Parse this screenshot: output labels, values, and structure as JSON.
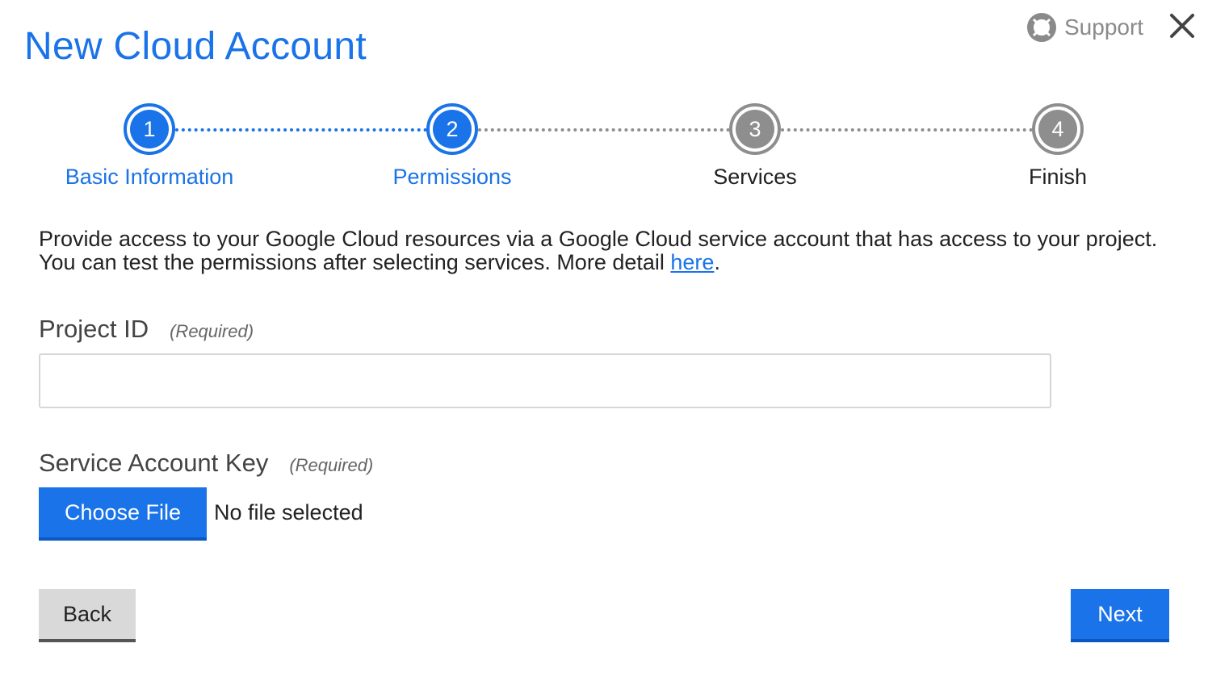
{
  "dialog": {
    "title": "New Cloud Account",
    "support_label": "Support"
  },
  "stepper": {
    "steps": [
      {
        "number": "1",
        "label": "Basic Information",
        "state": "active"
      },
      {
        "number": "2",
        "label": "Permissions",
        "state": "active"
      },
      {
        "number": "3",
        "label": "Services",
        "state": "inactive"
      },
      {
        "number": "4",
        "label": "Finish",
        "state": "inactive"
      }
    ]
  },
  "description": {
    "text": "Provide access to your Google Cloud resources via a Google Cloud service account that has access to your project. You can test the permissions after selecting services. More detail ",
    "link_text": "here",
    "suffix": "."
  },
  "fields": {
    "project_id": {
      "label": "Project ID",
      "required": "(Required)",
      "value": "",
      "placeholder": ""
    },
    "service_account_key": {
      "label": "Service Account Key",
      "required": "(Required)",
      "button_label": "Choose File",
      "file_status": "No file selected"
    }
  },
  "actions": {
    "back_label": "Back",
    "next_label": "Next"
  },
  "colors": {
    "accent": "#1a73e8",
    "inactive": "#8e8e8e"
  },
  "icons": {
    "support": "lifebuoy-icon",
    "close": "close-icon"
  }
}
